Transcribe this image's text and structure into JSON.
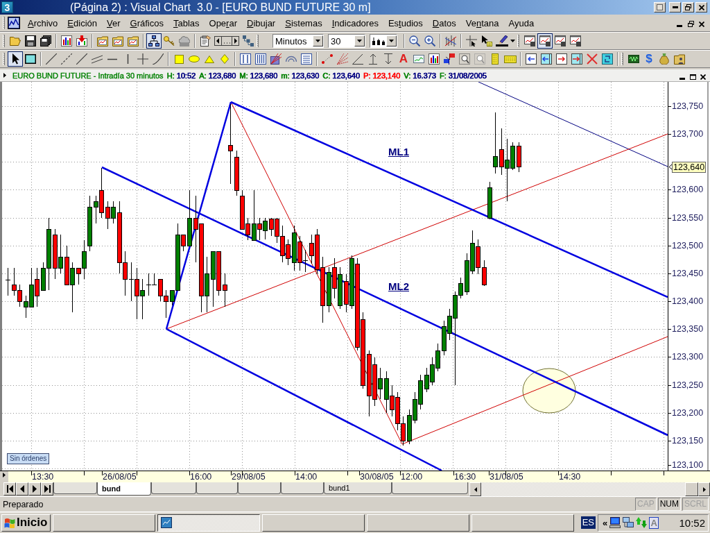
{
  "window": {
    "icon_label": "3",
    "title": "(Página 2) : Visual Chart  3.0 - [EURO BUND FUTURE 30 m]"
  },
  "menu": [
    {
      "key": "A",
      "after": "rchivo"
    },
    {
      "key": "E",
      "after": "dición"
    },
    {
      "key": "V",
      "after": "er"
    },
    {
      "key": "G",
      "after": "ráficos"
    },
    {
      "key": "T",
      "after": "ablas"
    },
    {
      "before": "Ope",
      "key": "r",
      "after": "ar"
    },
    {
      "key": "D",
      "after": "ibujar"
    },
    {
      "key": "S",
      "after": "istemas"
    },
    {
      "key": "I",
      "after": "ndicadores"
    },
    {
      "before": "Es",
      "key": "t",
      "after": "udios"
    },
    {
      "key": "D",
      "after": "atos"
    },
    {
      "before": "Ve",
      "key": "n",
      "after": "tana"
    },
    {
      "after": "Ayuda"
    }
  ],
  "toolbar_1": {
    "buttons": [
      {
        "pressed": false
      },
      {
        "pressed": false
      },
      {
        "pressed": false
      },
      {
        "pressed": false
      },
      {
        "pressed": false
      },
      {
        "pressed": false
      },
      {
        "pressed": false
      },
      {
        "pressed": false
      },
      {
        "pressed": true
      },
      {
        "pressed": false
      },
      {
        "pressed": false
      },
      {
        "pressed": false
      },
      {
        "pressed": false
      },
      {
        "pressed": false
      },
      {
        "pressed": false
      },
      {
        "pressed": false
      },
      {
        "pressed": false
      },
      {
        "pressed": false
      },
      {
        "pressed": false
      },
      {
        "pressed": false
      },
      {
        "pressed": false
      },
      {
        "pressed": true
      },
      {
        "pressed": false
      },
      {
        "pressed": false
      }
    ],
    "unit_dropdown": {
      "value": "Minutos"
    },
    "period_dropdown": {
      "value": "30"
    }
  },
  "toolbar_2": {
    "buttons": [
      {
        "pressed": true
      },
      {
        "pressed": false
      },
      {
        "pressed": false
      },
      {
        "pressed": false
      },
      {
        "pressed": false
      },
      {
        "pressed": false
      },
      {
        "pressed": false
      },
      {
        "pressed": false
      },
      {
        "pressed": false
      },
      {
        "pressed": false
      },
      {
        "pressed": false
      },
      {
        "pressed": false
      },
      {
        "pressed": false
      },
      {
        "pressed": false
      },
      {
        "pressed": false
      },
      {
        "pressed": false
      },
      {
        "pressed": false
      },
      {
        "pressed": false
      },
      {
        "pressed": false
      },
      {
        "pressed": false
      },
      {
        "pressed": false
      },
      {
        "pressed": false
      },
      {
        "pressed": false
      },
      {
        "pressed": false
      },
      {
        "pressed": false,
        "text": "A"
      },
      {
        "pressed": false
      },
      {
        "pressed": false
      },
      {
        "pressed": false
      },
      {
        "pressed": false
      },
      {
        "pressed": false
      },
      {
        "pressed": false
      },
      {
        "pressed": false
      },
      {
        "pressed": false
      },
      {
        "pressed": false
      },
      {
        "pressed": false
      },
      {
        "pressed": false
      },
      {
        "pressed": false
      },
      {
        "pressed": false
      },
      {
        "pressed": false
      },
      {
        "pressed": false,
        "text": "$"
      },
      {
        "pressed": false
      },
      {
        "pressed": false
      }
    ]
  },
  "chart_window": {
    "instrument": "EURO BUND FUTURE - Intradía 30 minutos",
    "fields": [
      {
        "label": {
          "text": "H:",
          "color": "#008000"
        },
        "value": {
          "text": "10:52",
          "color": "#000080"
        }
      },
      {
        "label": {
          "text": "A:",
          "color": "#008000"
        },
        "value": {
          "text": "123,680",
          "color": "#000080"
        }
      },
      {
        "label": {
          "text": "M:",
          "color": "#008000"
        },
        "value": {
          "text": "123,680",
          "color": "#000080"
        }
      },
      {
        "label": {
          "text": "m:",
          "color": "#008000"
        },
        "value": {
          "text": "123,630",
          "color": "#000080"
        }
      },
      {
        "label": {
          "text": "C:",
          "color": "#008000"
        },
        "value": {
          "text": "123,640",
          "color": "#000080"
        }
      },
      {
        "label": {
          "text": "P:",
          "color": "#ff0000"
        },
        "value": {
          "text": "123,140",
          "color": "#ff0000"
        }
      },
      {
        "label": {
          "text": "V:",
          "color": "#008000"
        },
        "value": {
          "text": "16.373",
          "color": "#000080"
        }
      },
      {
        "label": {
          "text": "F:",
          "color": "#008000"
        },
        "value": {
          "text": "31/08/2005",
          "color": "#000080"
        }
      }
    ],
    "labels": [
      "ML1",
      "ML2"
    ],
    "orders_badge": "Sin órdenes",
    "price_axis": [
      "123,750",
      "123,700",
      "123,600",
      "123,550",
      "123,500",
      "123,450",
      "123,400",
      "123,350",
      "123,300",
      "123,250",
      "123,200",
      "123,150",
      "123,100"
    ],
    "last_price": "123,640",
    "time_axis": [
      "13:30",
      "26/08/05",
      "16:00",
      "29/08/05",
      "14:00",
      "30/08/05",
      "12:00",
      "16:30",
      "31/08/05",
      "14:30"
    ]
  },
  "sheet_tabs": [
    {
      "selected": false
    },
    {
      "label": "bund",
      "selected": true
    },
    {
      "selected": false
    },
    {
      "selected": false
    },
    {
      "selected": false
    },
    {
      "selected": false
    },
    {
      "label": "bund1",
      "selected": false
    },
    {
      "selected": false
    }
  ],
  "status_bar": {
    "text": "Preparado",
    "indicators": [
      {
        "label": "CAP",
        "on": false
      },
      {
        "label": "NUM",
        "on": true
      },
      {
        "label": "SCRL",
        "on": false
      }
    ]
  },
  "taskbar": {
    "start": "Inicio",
    "tasks": [
      {
        "selected": false
      },
      {
        "selected": true
      },
      {
        "selected": false
      },
      {
        "selected": false
      },
      {
        "selected": false
      }
    ],
    "language": "ES",
    "tray_toggle": "«",
    "ime_indicator": "A",
    "clock": "10:52"
  }
}
